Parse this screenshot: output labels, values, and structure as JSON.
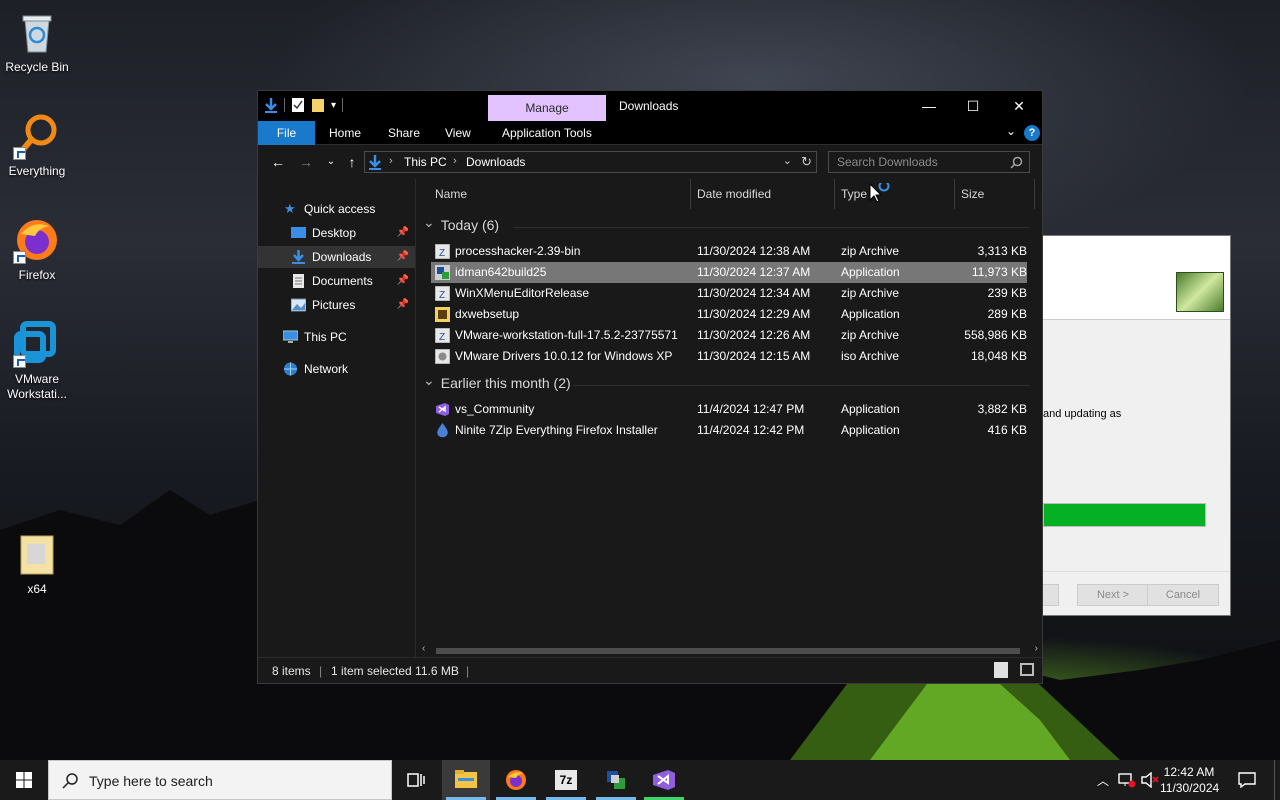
{
  "desktop": {
    "icons": [
      {
        "label": "Recycle Bin"
      },
      {
        "label": "Everything"
      },
      {
        "label": "Firefox"
      },
      {
        "label": "VMware Workstati..."
      },
      {
        "label": "x64"
      }
    ]
  },
  "installer": {
    "text": "and updating as",
    "next_label": "Next >",
    "cancel_label": "Cancel",
    "progress": 1.0,
    "progress_color": "#06b025"
  },
  "explorer": {
    "title": "Downloads",
    "manage_tab": "Manage",
    "manage_color": "#e2c3ff",
    "ribbon_tabs": [
      "File",
      "Home",
      "Share",
      "View",
      "Application Tools"
    ],
    "accent": "#1979ca",
    "help_label": "?",
    "address": {
      "root": "This PC",
      "current": "Downloads"
    },
    "search": {
      "placeholder": "Search Downloads"
    },
    "nav": {
      "quick_access": "Quick access",
      "desktop": "Desktop",
      "downloads": "Downloads",
      "documents": "Documents",
      "pictures": "Pictures",
      "this_pc": "This PC",
      "network": "Network"
    },
    "columns": [
      "Name",
      "Date modified",
      "Type",
      "Size"
    ],
    "groups": [
      {
        "title": "Today (6)",
        "files": [
          {
            "name": "processhacker-2.39-bin",
            "date": "11/30/2024 12:38 AM",
            "type": "zip Archive",
            "size": "3,313 KB",
            "icon": "zip-archive-icon"
          },
          {
            "name": "idman642build25",
            "date": "11/30/2024 12:37 AM",
            "type": "Application",
            "size": "11,973 KB",
            "icon": "installer-icon"
          },
          {
            "name": "WinXMenuEditorRelease",
            "date": "11/30/2024 12:34 AM",
            "type": "zip Archive",
            "size": "239 KB",
            "icon": "zip-archive-icon"
          },
          {
            "name": "dxwebsetup",
            "date": "11/30/2024 12:29 AM",
            "type": "Application",
            "size": "289 KB",
            "icon": "application-icon"
          },
          {
            "name": "VMware-workstation-full-17.5.2-23775571",
            "date": "11/30/2024 12:26 AM",
            "type": "zip Archive",
            "size": "558,986 KB",
            "icon": "zip-archive-icon"
          },
          {
            "name": "VMware Drivers 10.0.12 for Windows XP",
            "date": "11/30/2024 12:15 AM",
            "type": "iso Archive",
            "size": "18,048 KB",
            "icon": "iso-archive-icon"
          }
        ]
      },
      {
        "title": "Earlier this month (2)",
        "files": [
          {
            "name": "vs_Community",
            "date": "11/4/2024 12:47 PM",
            "type": "Application",
            "size": "3,882 KB",
            "icon": "visual-studio-icon"
          },
          {
            "name": "Ninite 7Zip Everything Firefox Installer",
            "date": "11/4/2024 12:42 PM",
            "type": "Application",
            "size": "416 KB",
            "icon": "ninite-icon"
          }
        ]
      }
    ],
    "selected_row": "idman642build25",
    "status": {
      "items": "8 items",
      "selected": "1 item selected  11.6 MB"
    }
  },
  "taskbar": {
    "search_placeholder": "Type here to search",
    "time": "12:42 AM",
    "date": "11/30/2024",
    "apps": [
      "file-explorer-icon",
      "firefox-icon",
      "7zip-icon",
      "installer-icon",
      "visual-studio-icon"
    ]
  }
}
